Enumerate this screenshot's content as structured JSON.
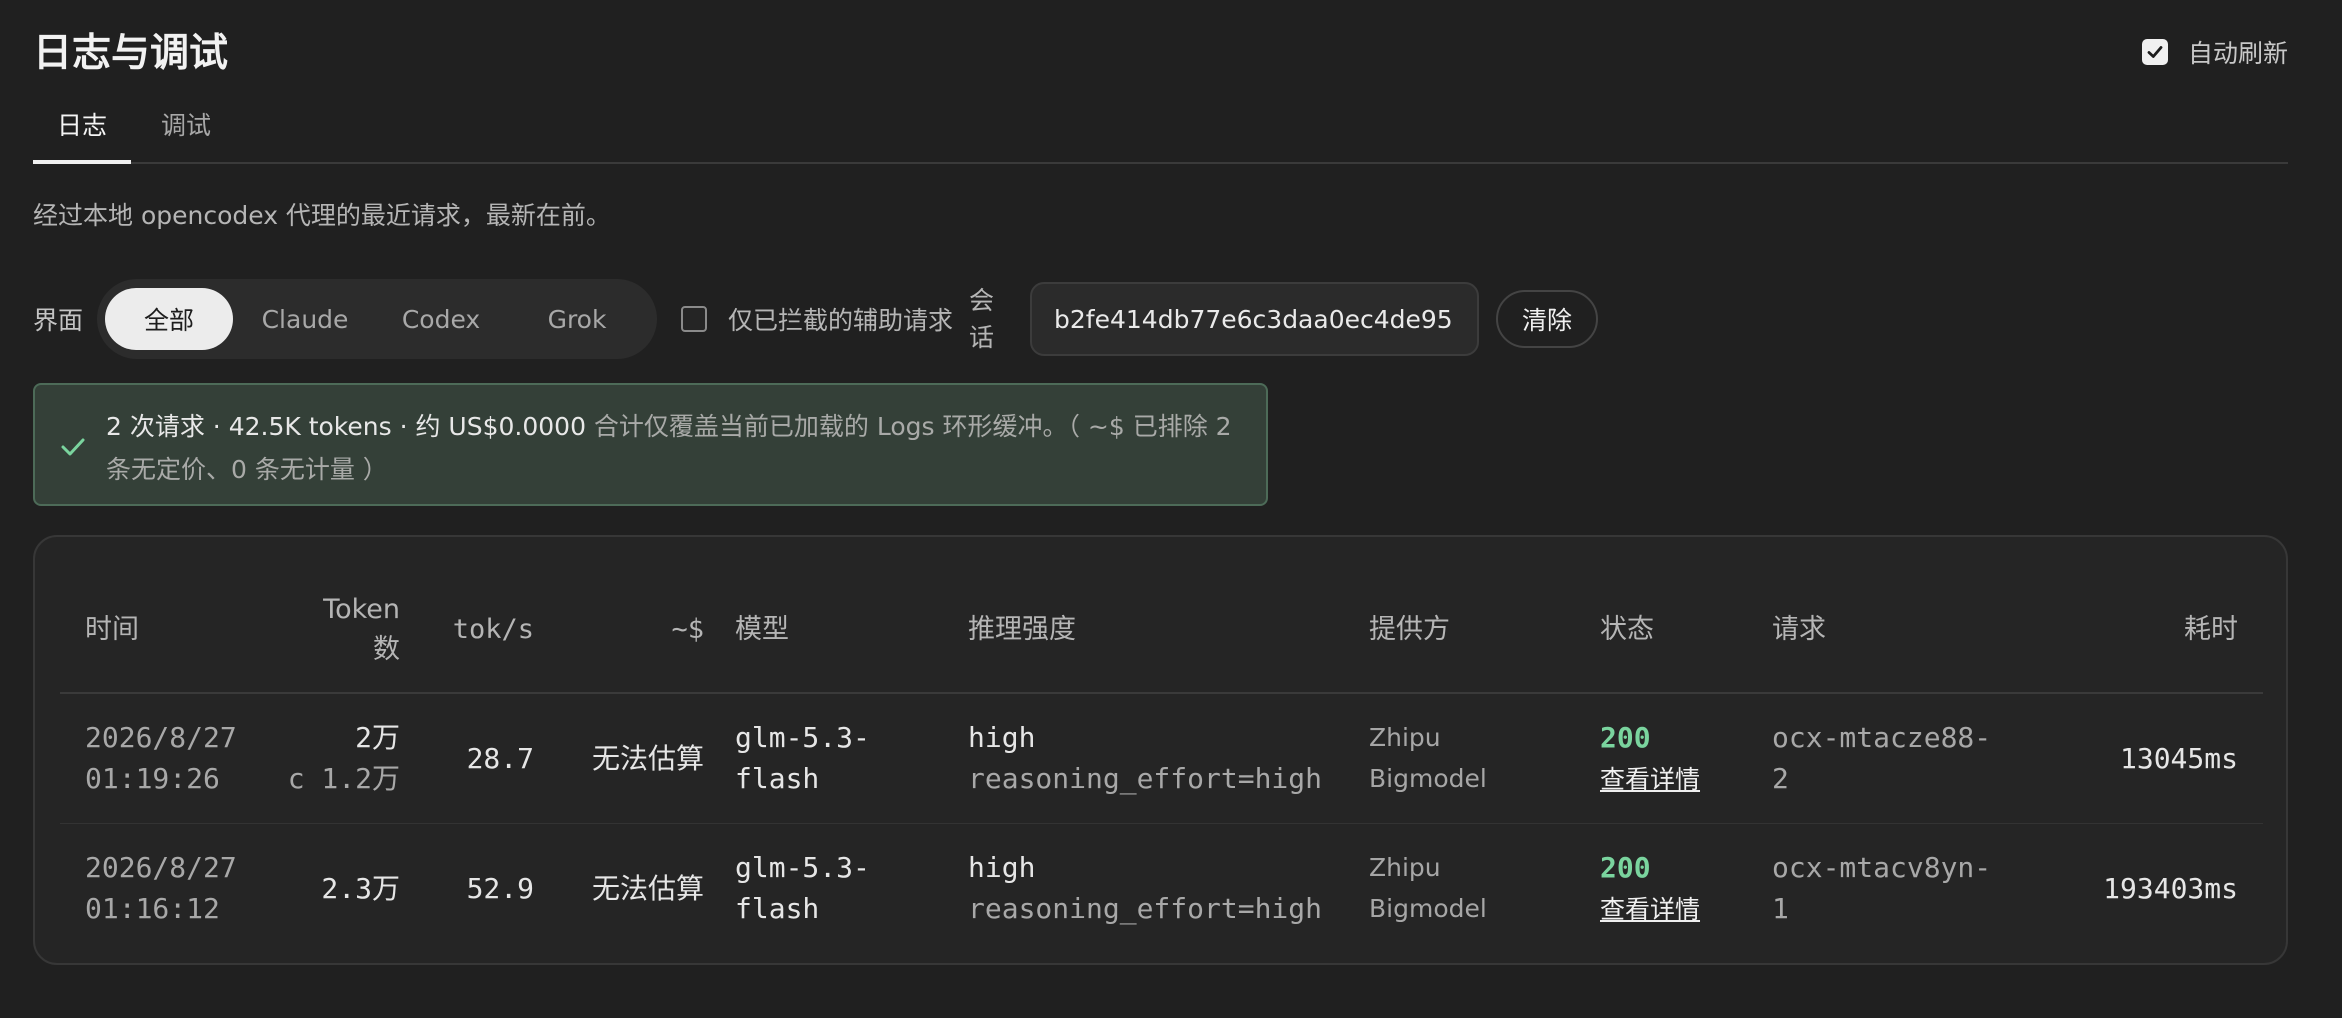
{
  "page": {
    "title": "日志与调试",
    "auto_refresh_label": "自动刷新",
    "auto_refresh_checked": true
  },
  "tabs": [
    {
      "label": "日志",
      "active": true
    },
    {
      "label": "调试",
      "active": false
    }
  ],
  "subtitle": "经过本地 opencodex 代理的最近请求，最新在前。",
  "filters": {
    "surface_label": "界面",
    "surface_options": [
      "全部",
      "Claude",
      "Codex",
      "Grok"
    ],
    "surface_selected": "全部",
    "only_blocked_label": "仅已拦截的辅助请求",
    "only_blocked_checked": false,
    "session_label": "会话",
    "session_value": "b2fe414db77e6c3daa0ec4de95",
    "clear_label": "清除"
  },
  "notice": {
    "icon": "check-icon",
    "summary": "2 次请求 · 42.5K tokens · 约 US$0.0000",
    "detail_line1": " 合计仅覆盖当前已加载的 Logs 环形缓冲。（ ~$ 已排除 2",
    "detail_line2": "条无定价、0 条无计量 ）"
  },
  "table": {
    "columns": {
      "time": "时间",
      "tokens_line1": "Token",
      "tokens_line2": "数",
      "tps": "tok/s",
      "cost": "~$",
      "model": "模型",
      "effort": "推理强度",
      "provider": "提供方",
      "status": "状态",
      "request": "请求",
      "duration": "耗时"
    },
    "rows": [
      {
        "date": "2026/8/27",
        "time": "01:19:26",
        "tokens": "2万",
        "tokens_cached": "c 1.2万",
        "tps": "28.7",
        "cost": "无法估算",
        "model_line1": "glm-5.3-",
        "model_line2": "flash",
        "effort": "high",
        "effort_detail": "reasoning_effort=high",
        "provider_line1": "Zhipu",
        "provider_line2": "Bigmodel",
        "status": "200",
        "detail_link": "查看详情",
        "request_line1": "ocx-mtacze88-",
        "request_line2": "2",
        "duration": "13045ms"
      },
      {
        "date": "2026/8/27",
        "time": "01:16:12",
        "tokens": "2.3万",
        "tokens_cached": "",
        "tps": "52.9",
        "cost": "无法估算",
        "model_line1": "glm-5.3-",
        "model_line2": "flash",
        "effort": "high",
        "effort_detail": "reasoning_effort=high",
        "provider_line1": "Zhipu",
        "provider_line2": "Bigmodel",
        "status": "200",
        "detail_link": "查看详情",
        "request_line1": "ocx-mtacv8yn-",
        "request_line2": "1",
        "duration": "193403ms"
      }
    ]
  },
  "colors": {
    "background": "#202020",
    "status_ok": "#7ad49e",
    "notice_bg": "#344038",
    "notice_border": "#4d6b58"
  }
}
